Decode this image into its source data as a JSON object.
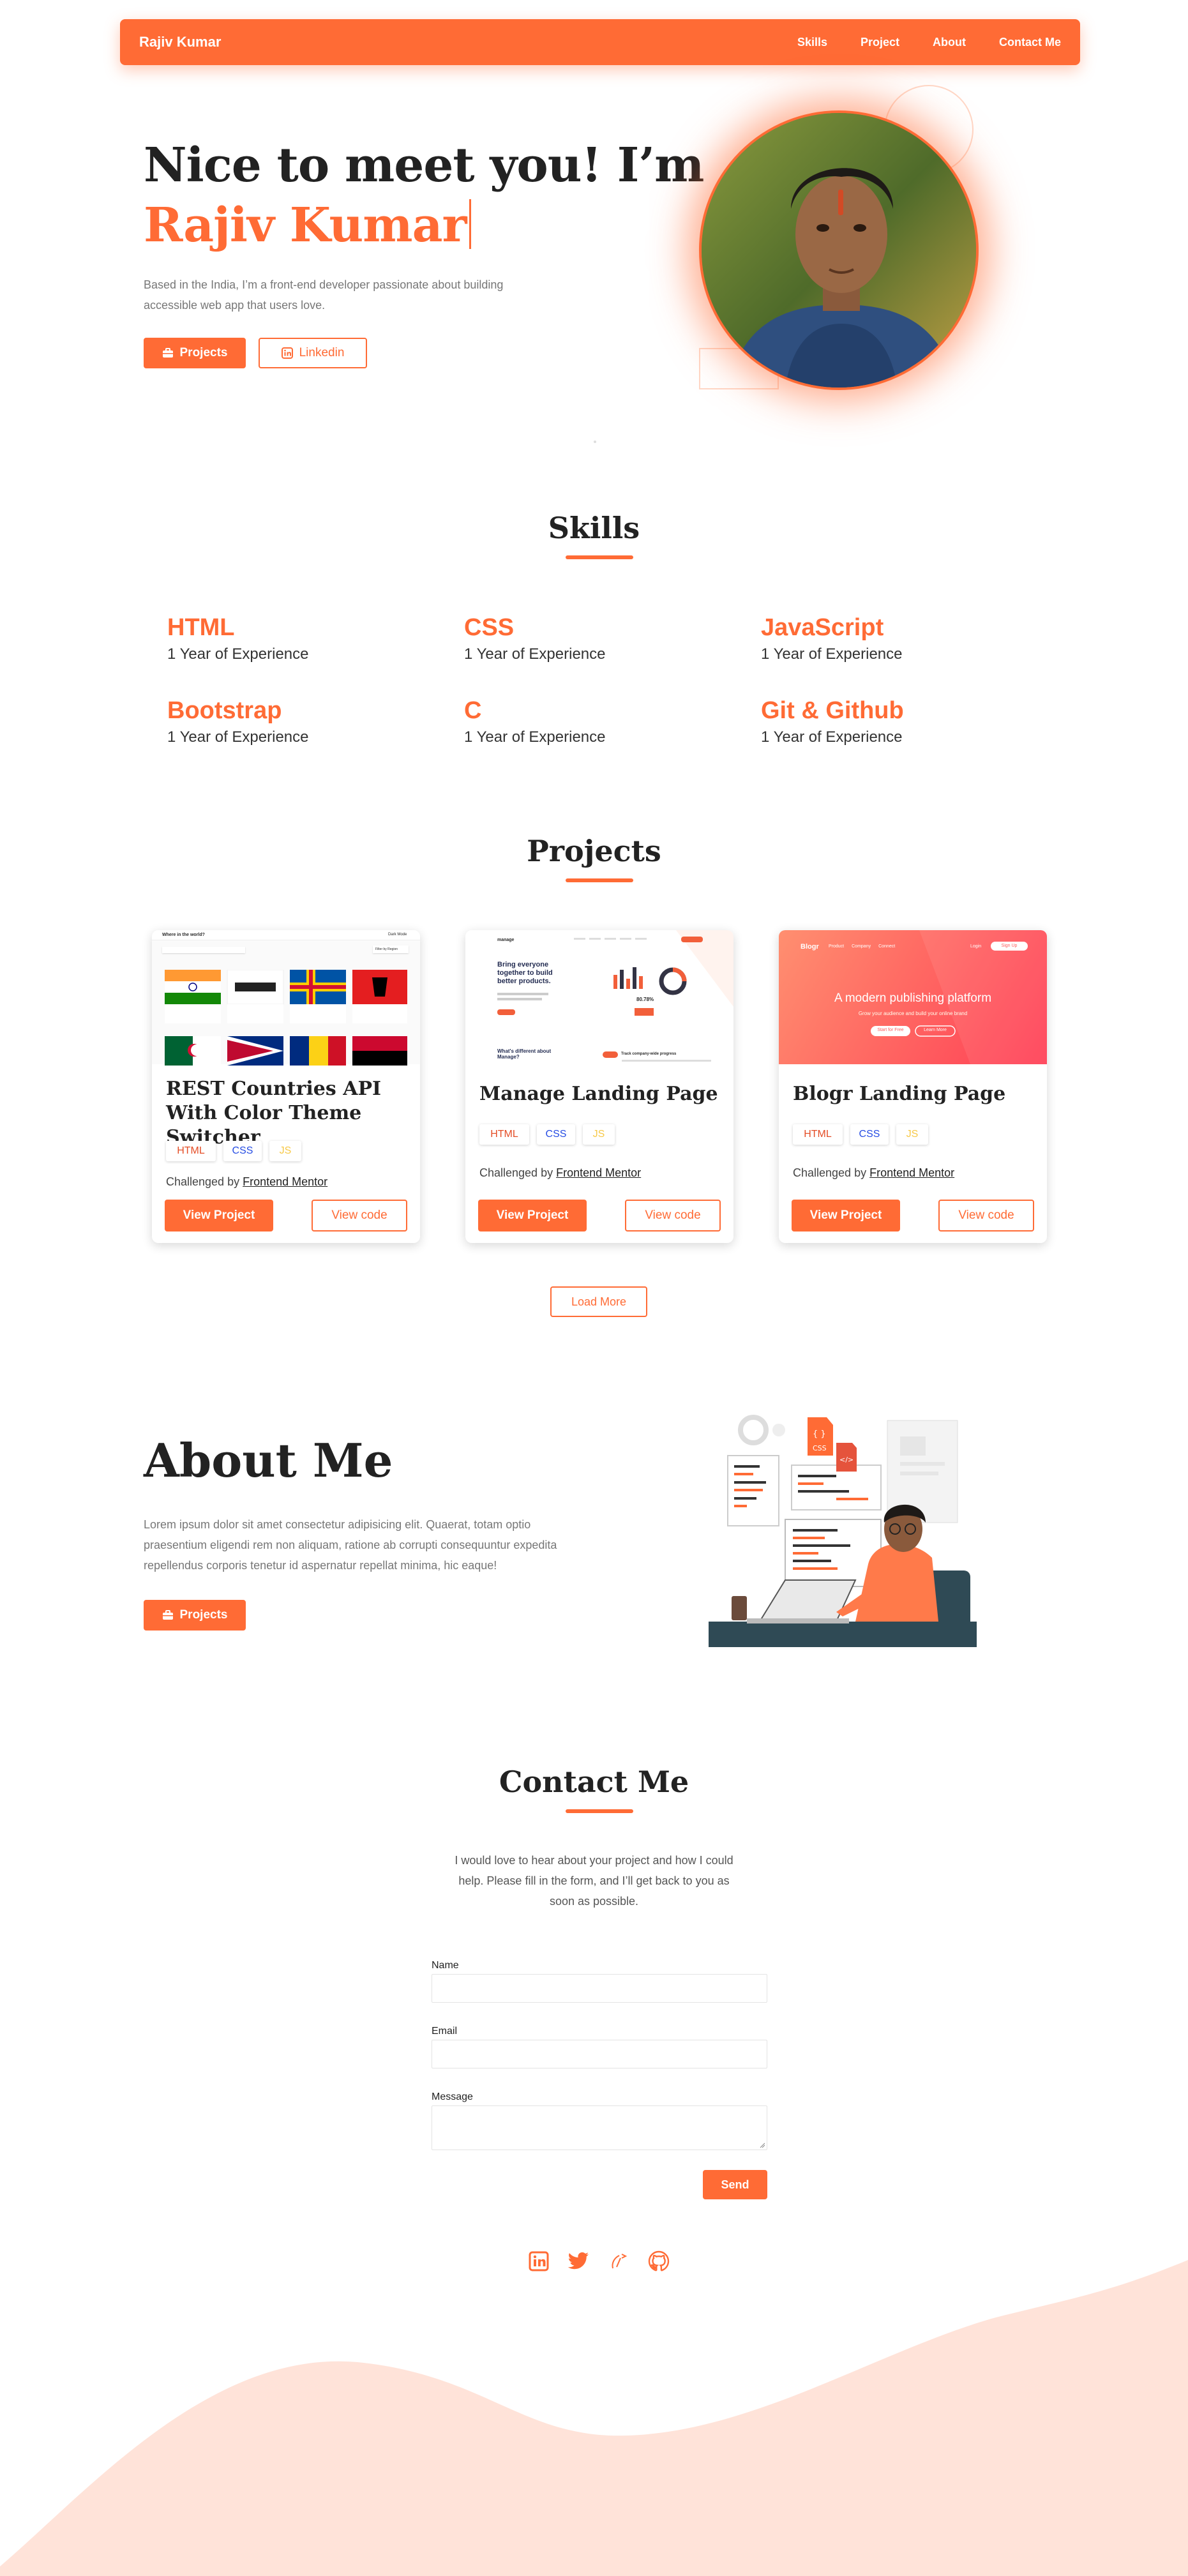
{
  "nav": {
    "brand": "Rajiv Kumar",
    "links": [
      "Skills",
      "Project",
      "About",
      "Contact Me"
    ]
  },
  "hero": {
    "greeting": "Nice to meet you! I’m",
    "name": "Rajiv Kumar",
    "description": "Based in the India, I’m a front-end developer passionate about building accessible web app that users love.",
    "projects_button": "Projects",
    "linkedin_button": "Linkedin"
  },
  "skills": {
    "title": "Skills",
    "items": [
      {
        "name": "HTML",
        "experience": "1 Year of Experience"
      },
      {
        "name": "CSS",
        "experience": "1 Year of Experience"
      },
      {
        "name": "JavaScript",
        "experience": "1 Year of Experience"
      },
      {
        "name": "Bootstrap",
        "experience": "1 Year of Experience"
      },
      {
        "name": "C",
        "experience": "1 Year of Experience"
      },
      {
        "name": "Git & Github",
        "experience": "1 Year of Experience"
      }
    ]
  },
  "projects": {
    "title": "Projects",
    "challenged_by": "Challenged by",
    "mentor": "Frontend Mentor",
    "view_project": "View Project",
    "view_code": "View code",
    "tags": [
      "HTML",
      "CSS",
      "JS"
    ],
    "cards": [
      {
        "title": "REST Countries API With Color Theme Switcher"
      },
      {
        "title": "Manage Landing Page"
      },
      {
        "title": "Blogr Landing Page"
      }
    ],
    "load_more": "Load More"
  },
  "about": {
    "title": "About Me",
    "text": "Lorem ipsum dolor sit amet consectetur adipisicing elit. Quaerat, totam optio praesentium eligendi rem non aliquam, ratione ab corrupti consequuntur expedita repellendus corporis tenetur id aspernatur repellat minima, hic eaque!",
    "projects_button": "Projects"
  },
  "contact": {
    "title": "Contact Me",
    "intro": "I would love to hear about your project and how I could help. Please fill in the form, and I’ll get back to you as soon as possible.",
    "name_label": "Name",
    "email_label": "Email",
    "message_label": "Message",
    "send_button": "Send"
  },
  "mock_countries": {
    "header": "Where in the world?",
    "mode": "Dark Mode",
    "filter": "Filter by Region"
  },
  "mock_manage": {
    "logo": "manage",
    "headline": "Bring everyone together to build better products.",
    "stat": "80.78%",
    "subhead": "What's different about Manage?",
    "feature": "Track company-wide progress"
  },
  "mock_blogr": {
    "logo": "Blogr",
    "nav": [
      "Product",
      "Company",
      "Connect"
    ],
    "login": "Login",
    "signup": "Sign Up",
    "headline": "A modern publishing platform",
    "sub": "Grow your audience and build your online brand",
    "start": "Start for Free",
    "learn": "Learn More"
  },
  "colors": {
    "accent": "#ff6b35",
    "wave": "#ffe3d9",
    "html_tag": "#e44d26",
    "css_tag": "#264de4",
    "js_tag": "#f7c948"
  }
}
